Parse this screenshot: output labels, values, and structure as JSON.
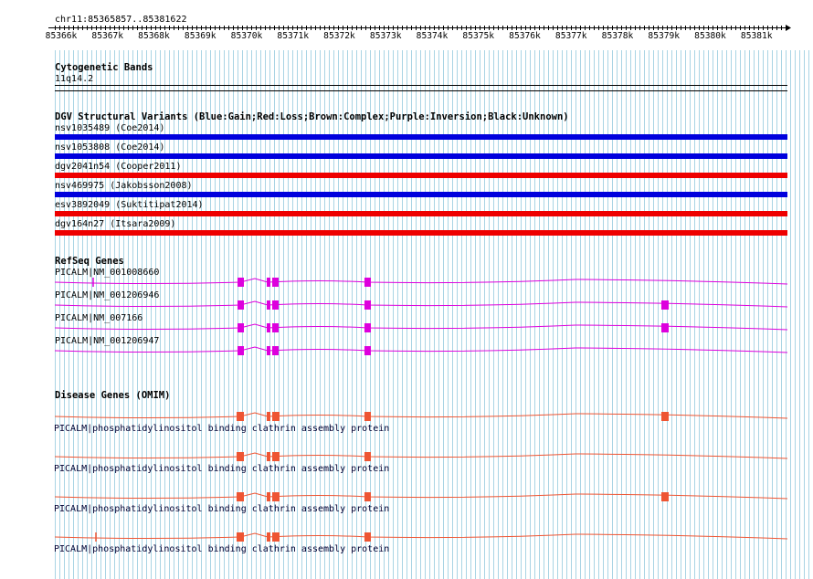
{
  "location": "chr11:85365857..85381622",
  "ruler": {
    "ticks": [
      "85366k",
      "85367k",
      "85368k",
      "85369k",
      "85370k",
      "85371k",
      "85372k",
      "85373k",
      "85374k",
      "85375k",
      "85376k",
      "85377k",
      "85378k",
      "85379k",
      "85380k",
      "85381k"
    ]
  },
  "cytoband": {
    "title": "Cytogenetic Bands",
    "band": "11q14.2"
  },
  "dgv": {
    "title": "DGV Structural Variants (Blue:Gain;Red:Loss;Brown:Complex;Purple:Inversion;Black:Unknown)",
    "items": [
      {
        "label": "nsv1035489 (Coe2014)",
        "type": "Gain",
        "color": "#0000dd"
      },
      {
        "label": "nsv1053808 (Coe2014)",
        "type": "Gain",
        "color": "#0000dd"
      },
      {
        "label": "dgv2041n54 (Cooper2011)",
        "type": "Loss",
        "color": "#ee0000"
      },
      {
        "label": "nsv469975 (Jakobsson2008)",
        "type": "Gain",
        "color": "#0000dd"
      },
      {
        "label": "esv3892049 (Suktitipat2014)",
        "type": "Loss",
        "color": "#ee0000"
      },
      {
        "label": "dgv164n27 (Itsara2009)",
        "type": "Loss",
        "color": "#ee0000"
      }
    ]
  },
  "refseq": {
    "title": "RefSeq Genes",
    "color": "#dd00dd",
    "items": [
      {
        "label": "PICALM|NM_001008660"
      },
      {
        "label": "PICALM|NM_001206946"
      },
      {
        "label": "PICALM|NM_007166"
      },
      {
        "label": "PICALM|NM_001206947"
      }
    ]
  },
  "omim": {
    "title": "Disease Genes (OMIM)",
    "color": "#ee5533",
    "items": [
      {
        "label": "PICALM|phosphatidylinositol binding clathrin assembly protein"
      },
      {
        "label": "PICALM|phosphatidylinositol binding clathrin assembly protein"
      },
      {
        "label": "PICALM|phosphatidylinositol binding clathrin assembly protein"
      },
      {
        "label": "PICALM|phosphatidylinositol binding clathrin assembly protein"
      }
    ]
  }
}
